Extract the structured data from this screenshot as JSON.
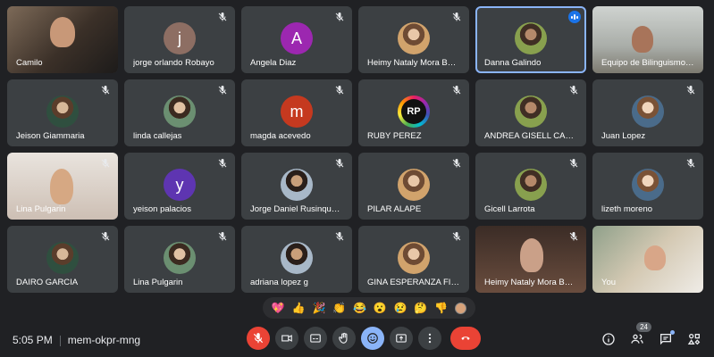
{
  "participants": [
    {
      "name": "Camilo",
      "type": "video",
      "video": "cam-a"
    },
    {
      "name": "jorge orlando Robayo",
      "type": "letter",
      "letter": "j",
      "color": "#8d6e63"
    },
    {
      "name": "Angela Diaz",
      "type": "letter",
      "letter": "A",
      "color": "#9c27b0"
    },
    {
      "name": "Heimy Nataly Mora Barah...",
      "type": "photo"
    },
    {
      "name": "Danna Galindo",
      "type": "photo",
      "speaking": true
    },
    {
      "name": "Equipo de Bilinguismo 20...",
      "type": "video",
      "video": "cam-b"
    },
    {
      "name": "Jeison Giammaria",
      "type": "photo"
    },
    {
      "name": "linda callejas",
      "type": "photo"
    },
    {
      "name": "magda acevedo",
      "type": "letter",
      "letter": "m",
      "color": "#c5391f"
    },
    {
      "name": "RUBY PEREZ",
      "type": "logo",
      "logo_text": "RP"
    },
    {
      "name": "ANDREA GISELL CARRILL...",
      "type": "photo"
    },
    {
      "name": "Juan Lopez",
      "type": "photo"
    },
    {
      "name": "Lina Pulgarin",
      "type": "video",
      "video": "cam-c"
    },
    {
      "name": "yeison palacios",
      "type": "letter",
      "letter": "y",
      "color": "#5e35b1"
    },
    {
      "name": "Jorge Daniel Rusinque Al...",
      "type": "photo"
    },
    {
      "name": "PILAR ALAPE",
      "type": "photo"
    },
    {
      "name": "Gicell Larrota",
      "type": "photo"
    },
    {
      "name": "lizeth moreno",
      "type": "photo"
    },
    {
      "name": "DAIRO GARCIA",
      "type": "photo"
    },
    {
      "name": "Lina Pulgarin",
      "type": "photo"
    },
    {
      "name": "adriana lopez g",
      "type": "photo"
    },
    {
      "name": "GINA ESPERANZA FIAGA ...",
      "type": "photo"
    },
    {
      "name": "Heimy Nataly Mora Barah...",
      "type": "video",
      "video": "cam-d"
    },
    {
      "name": "You",
      "type": "video",
      "video": "cam-e"
    }
  ],
  "reactions": [
    "💖",
    "👍",
    "🎉",
    "👏",
    "😂",
    "😮",
    "😢",
    "🤔",
    "👎"
  ],
  "meeting": {
    "time": "5:05 PM",
    "code": "mem-okpr-mng"
  },
  "controls": [
    "mic-off",
    "camera",
    "captions",
    "raise-hand",
    "emoji",
    "present",
    "more-options",
    "end-call"
  ],
  "side": {
    "participants_count": "24"
  },
  "colors": {
    "background": "#202124",
    "tile": "#3c4043",
    "accent": "#8ab4f8",
    "danger": "#ea4335"
  }
}
